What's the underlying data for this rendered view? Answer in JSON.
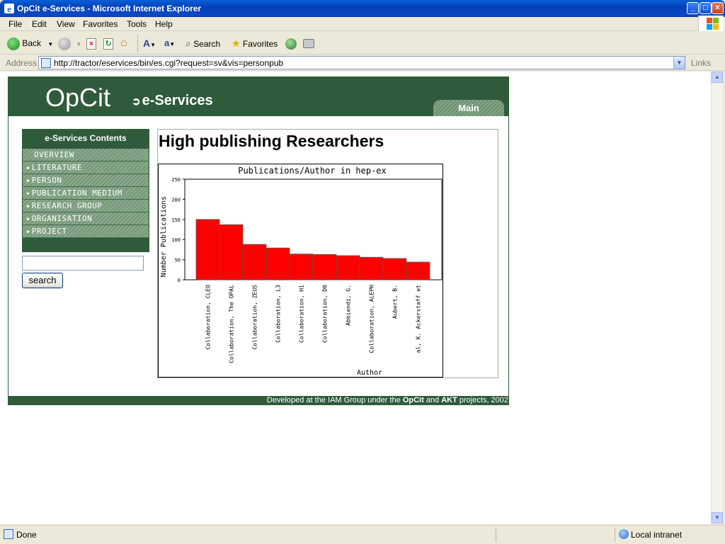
{
  "window": {
    "title": "OpCit e-Services - Microsoft Internet Explorer",
    "minimize": "_",
    "maximize": "□",
    "close": "×"
  },
  "menubar": [
    "File",
    "Edit",
    "View",
    "Favorites",
    "Tools",
    "Help"
  ],
  "toolbar": {
    "back": "Back",
    "search": "Search",
    "favorites": "Favorites"
  },
  "address": {
    "label": "Address",
    "url": "http://tractor/eservices/bin/es.cgi?request=sv&vis=personpub",
    "links": "Links"
  },
  "status": {
    "text": "Done",
    "zone": "Local intranet"
  },
  "page": {
    "logo": "OpCit",
    "subtitle": "e-Services",
    "subtitle_arrow": "➲",
    "tab_main": "Main",
    "sidebar_title": "e-Services Contents",
    "nav": [
      {
        "label": "Overview",
        "active": true
      },
      {
        "label": "Literature",
        "active": false
      },
      {
        "label": "Person",
        "active": false
      },
      {
        "label": "Publication Medium",
        "active": false
      },
      {
        "label": "Research Group",
        "active": false
      },
      {
        "label": "Organisation",
        "active": false
      },
      {
        "label": "Project",
        "active": false
      }
    ],
    "search_button": "search",
    "search_value": "",
    "heading": "High publishing Researchers",
    "footer_prefix": "Developed at the IAM Group under the ",
    "footer_opcit": "OpCit",
    "footer_and": " and ",
    "footer_akt": "AKT",
    "footer_suffix": " projects, 2002"
  },
  "colors": {
    "header_green": "#2f5b3b",
    "bar_red": "#ff0000"
  },
  "chart_data": {
    "type": "bar",
    "title": "Publications/Author in hep-ex",
    "xlabel": "Author",
    "ylabel": "Number Publications",
    "ylim": [
      0,
      250
    ],
    "yticks": [
      0,
      50,
      100,
      150,
      200,
      250
    ],
    "categories": [
      "Collaboration, CLEO",
      "Collaboration, The OPAL",
      "Collaboration, ZEUS",
      "Collaboration, L3",
      "Collaboration, H1",
      "Collaboration, D0",
      "Abbiendi, G.",
      "Collaboration, ALEPH",
      "Aubert, B.",
      "al, K. Ackerstaff et"
    ],
    "values": [
      150,
      137,
      88,
      79,
      64,
      63,
      60,
      56,
      53,
      44
    ]
  }
}
